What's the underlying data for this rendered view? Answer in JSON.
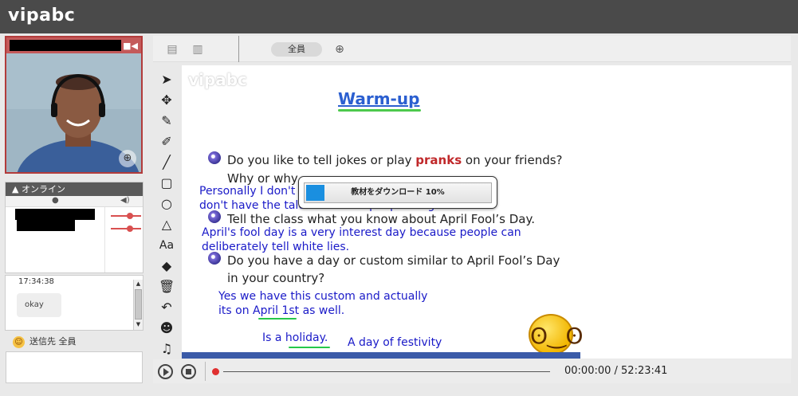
{
  "app": {
    "logo": "vipabc"
  },
  "video": {
    "camera_icon": "camera-icon",
    "zoom_icon": "zoom-in-icon"
  },
  "online": {
    "header": "オンライン",
    "user_icon": "user-icon",
    "volume_icon": "volume-icon",
    "users": [
      {
        "name": "",
        "volume_level": 0.65
      },
      {
        "name": "",
        "volume_level": 0.65
      }
    ]
  },
  "chat": {
    "timestamp": "17:34:38",
    "message": "okay",
    "sendto_label": "送信先 全員",
    "input_placeholder": ""
  },
  "toolbar": {
    "all_label": "全員"
  },
  "slide": {
    "watermark": "vipabc",
    "title": "Warm-up",
    "q1_prefix": "Do you like to tell jokes or play ",
    "q1_highlight": "pranks",
    "q1_suffix": " on your friends?",
    "q1_line2": "Why or why",
    "q2": "Tell the class what you know about April Fool’s Day.",
    "q3_line1": "Do you have a day or custom similar to April Fool’s Day",
    "q3_line2": "in your country?",
    "ann1_line1": "Personally I don't",
    "ann1_line2": "don't have the talent to make people laugh.",
    "ann2_line1": "April's  fool day is a very interest day because people can",
    "ann2_line2": "deliberately tell white lies.",
    "ann3_line1": "Yes we have this custom and actually",
    "ann3_line2": "its on April 1st as well.",
    "ann4": "Is a holiday.",
    "ann5": "A day of festivity"
  },
  "progress": {
    "label": "教材をダウンロード 10%",
    "percent": 10
  },
  "playback": {
    "time": "00:00:00 / 52:23:41"
  }
}
